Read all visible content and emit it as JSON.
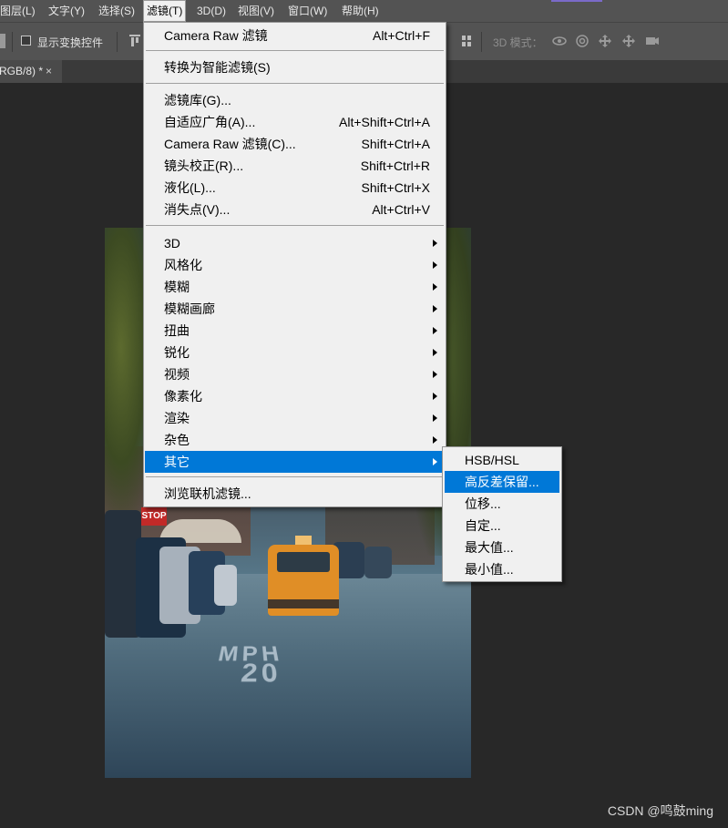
{
  "menubar": {
    "items": [
      {
        "label": "图层(L)"
      },
      {
        "label": "文字(Y)"
      },
      {
        "label": "选择(S)"
      },
      {
        "label": "滤镜(T)",
        "active": true
      },
      {
        "label": "3D(D)"
      },
      {
        "label": "视图(V)"
      },
      {
        "label": "窗口(W)"
      },
      {
        "label": "帮助(H)"
      }
    ]
  },
  "options_bar": {
    "show_transform_controls_label": "显示变换控件",
    "show_transform_controls_checked": false,
    "mode_3d_label": "3D 模式："
  },
  "document_tab": {
    "title": "RGB/8) *",
    "close_glyph": "×"
  },
  "filter_menu": {
    "items": [
      {
        "label": "Camera Raw 滤镜",
        "shortcut": "Alt+Ctrl+F"
      },
      {
        "label": "转换为智能滤镜(S)",
        "shortcut": ""
      },
      {
        "label": "滤镜库(G)...",
        "shortcut": ""
      },
      {
        "label": "自适应广角(A)...",
        "shortcut": "Alt+Shift+Ctrl+A"
      },
      {
        "label": "Camera Raw 滤镜(C)...",
        "shortcut": "Shift+Ctrl+A"
      },
      {
        "label": "镜头校正(R)...",
        "shortcut": "Shift+Ctrl+R"
      },
      {
        "label": "液化(L)...",
        "shortcut": "Shift+Ctrl+X"
      },
      {
        "label": "消失点(V)...",
        "shortcut": "Alt+Ctrl+V"
      },
      {
        "label": "3D",
        "submenu": true
      },
      {
        "label": "风格化",
        "submenu": true
      },
      {
        "label": "模糊",
        "submenu": true
      },
      {
        "label": "模糊画廊",
        "submenu": true
      },
      {
        "label": "扭曲",
        "submenu": true
      },
      {
        "label": "锐化",
        "submenu": true
      },
      {
        "label": "视频",
        "submenu": true
      },
      {
        "label": "像素化",
        "submenu": true
      },
      {
        "label": "渲染",
        "submenu": true
      },
      {
        "label": "杂色",
        "submenu": true
      },
      {
        "label": "其它",
        "submenu": true,
        "highlighted": true
      },
      {
        "label": "浏览联机滤镜...",
        "shortcut": ""
      }
    ]
  },
  "other_submenu": {
    "items": [
      {
        "label": "HSB/HSL"
      },
      {
        "label": "高反差保留...",
        "highlighted": true
      },
      {
        "label": "位移..."
      },
      {
        "label": "自定..."
      },
      {
        "label": "最大值..."
      },
      {
        "label": "最小值..."
      }
    ]
  },
  "canvas_photo": {
    "stop_sign_text": "STOP",
    "road_text_top": "MPH",
    "road_text_bottom": "20"
  },
  "watermark": "CSDN @鸣鼓ming",
  "colors": {
    "menu_highlight": "#0078d7",
    "app_bg": "#282828",
    "bar_bg": "#535353"
  }
}
